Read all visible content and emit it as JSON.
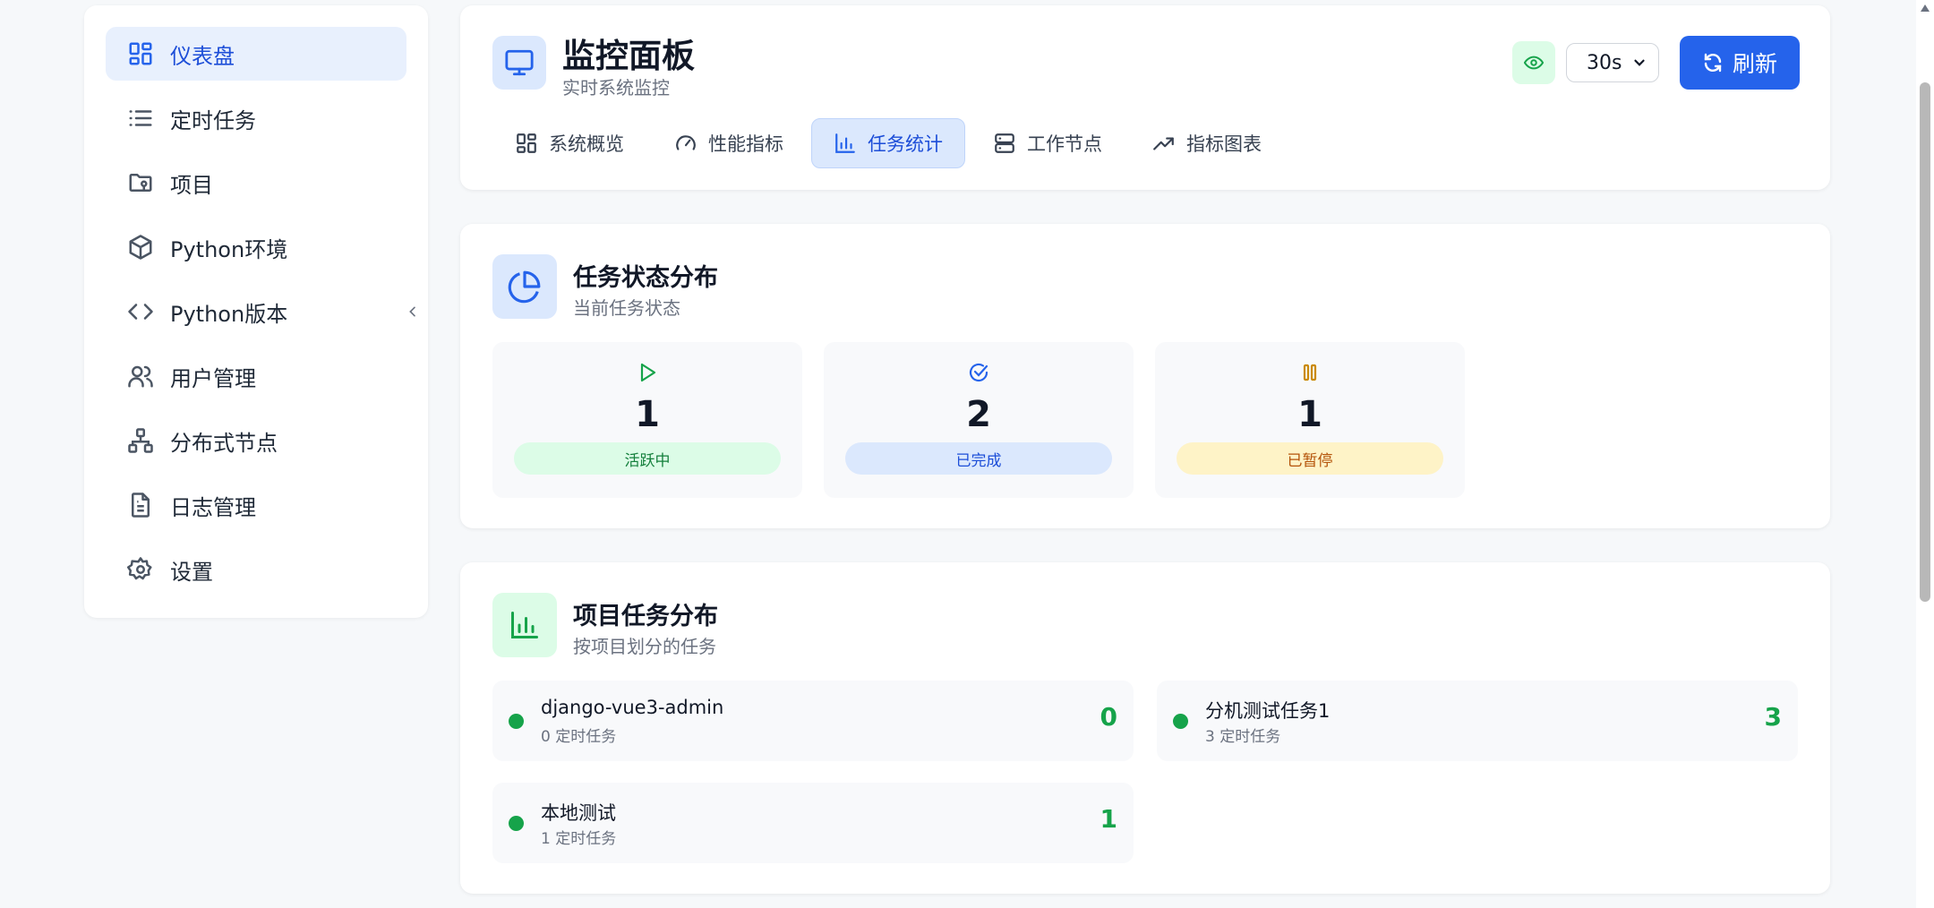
{
  "sidebar": {
    "items": [
      {
        "label": "仪表盘",
        "icon": "dashboard-icon",
        "active": true
      },
      {
        "label": "定时任务",
        "icon": "list-icon"
      },
      {
        "label": "项目",
        "icon": "folder-icon"
      },
      {
        "label": "Python环境",
        "icon": "box-icon"
      },
      {
        "label": "Python版本",
        "icon": "code-icon"
      },
      {
        "label": "用户管理",
        "icon": "users-icon"
      },
      {
        "label": "分布式节点",
        "icon": "network-icon"
      },
      {
        "label": "日志管理",
        "icon": "file-text-icon"
      },
      {
        "label": "设置",
        "icon": "gear-icon"
      }
    ]
  },
  "header": {
    "title": "监控面板",
    "subtitle": "实时系统监控",
    "interval": "30s",
    "refresh_label": "刷新"
  },
  "tabs": [
    {
      "label": "系统概览",
      "icon": "grid-icon"
    },
    {
      "label": "性能指标",
      "icon": "gauge-icon"
    },
    {
      "label": "任务统计",
      "icon": "bar-chart-icon",
      "active": true
    },
    {
      "label": "工作节点",
      "icon": "server-icon"
    },
    {
      "label": "指标图表",
      "icon": "trending-up-icon"
    }
  ],
  "task_status": {
    "title": "任务状态分布",
    "subtitle": "当前任务状态",
    "stats": [
      {
        "count": "1",
        "label": "活跃中",
        "icon": "play-icon",
        "color": "#16a34a"
      },
      {
        "count": "2",
        "label": "已完成",
        "icon": "check-circle-icon",
        "color": "#2563eb"
      },
      {
        "count": "1",
        "label": "已暂停",
        "icon": "pause-icon",
        "color": "#ca8a04"
      }
    ]
  },
  "project_tasks": {
    "title": "项目任务分布",
    "subtitle": "按项目划分的任务",
    "items": [
      {
        "name": "django-vue3-admin",
        "sub": "0 定时任务",
        "count": "0"
      },
      {
        "name": "分机测试任务1",
        "sub": "3 定时任务",
        "count": "3"
      },
      {
        "name": "本地测试",
        "sub": "1 定时任务",
        "count": "1"
      }
    ]
  }
}
